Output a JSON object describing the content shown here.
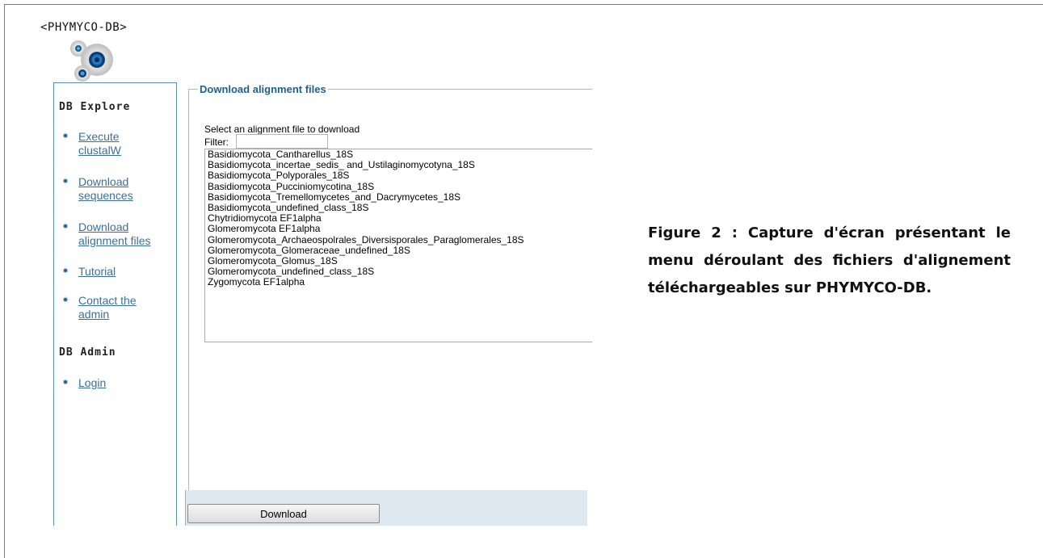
{
  "logo": {
    "text": "<PHYMYCO-DB>",
    "icon": "bubbles-logo-icon"
  },
  "sidebar": {
    "explore_heading": "DB Explore",
    "explore_items": [
      {
        "label_line1": "Execute",
        "label_line2": "clustalW"
      },
      {
        "label_line1": "Download",
        "label_line2": "sequences"
      },
      {
        "label_line1": "Download",
        "label_line2": "alignment files"
      },
      {
        "label_line1": "Tutorial",
        "label_line2": ""
      },
      {
        "label_line1": "Contact the",
        "label_line2": "admin"
      }
    ],
    "admin_heading": "DB Admin",
    "admin_items": [
      {
        "label_line1": "Login",
        "label_line2": ""
      }
    ]
  },
  "main": {
    "legend": "Download alignment files",
    "select_label": "Select an alignment file to download",
    "filter_label": "Filter:",
    "filter_value": "",
    "options": [
      "Basidiomycota_Cantharellus_18S",
      "Basidiomycota_incertae_sedis_ and_Ustilaginomycotyna_18S",
      "Basidiomycota_Polyporales_18S",
      "Basidiomycota_Pucciniomycotina_18S",
      "Basidiomycota_Tremellomycetes_and_Dacrymycetes_18S",
      "Basidiomycota_undefined_class_18S",
      "Chytridiomycota EF1alpha",
      "Glomeromycota EF1alpha",
      "Glomeromycota_Archaeospolrales_Diversisporales_Paraglomerales_18S",
      "Glomeromycota_Glomeraceae_undefined_18S",
      "Glomeromycota_Glomus_18S",
      "Glomeromycota_undefined_class_18S",
      "Zygomycota EF1alpha"
    ],
    "download_button": "Download"
  },
  "caption": {
    "text": "Figure 2 : Capture d'écran présentant le menu déroulant des fichiers d'alignement téléchargeables sur PHYMYCO-DB."
  },
  "colors": {
    "link": "#3a6f9c",
    "legend": "#1f5f8b",
    "panel_border": "#5a8fb8",
    "footer_bg": "#dde8f0"
  }
}
